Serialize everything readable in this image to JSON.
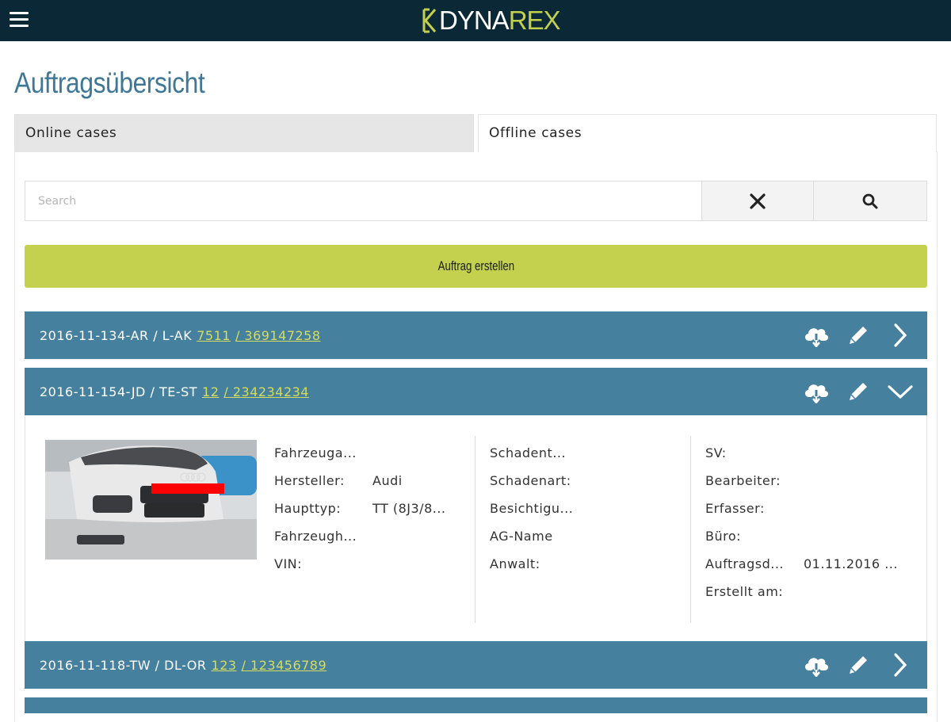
{
  "header": {
    "logo_part1": "DYNA",
    "logo_part2": "REX"
  },
  "page": {
    "title": "Auftragsübersicht"
  },
  "tabs": [
    {
      "label": "Online cases",
      "active": true
    },
    {
      "label": "Offline cases",
      "active": false
    }
  ],
  "search": {
    "placeholder": "Search",
    "value": ""
  },
  "create_button": {
    "label": "Auftrag erstellen"
  },
  "cases": [
    {
      "id": "2016-11-134-AR",
      "plate_prefix": "/ L-AK",
      "plate_number": "7511",
      "claim_number": "/ 369147258",
      "expanded": false
    },
    {
      "id": "2016-11-154-JD",
      "plate_prefix": "/ TE-ST",
      "plate_number": "12",
      "claim_number": "/ 234234234",
      "expanded": true
    },
    {
      "id": "2016-11-118-TW",
      "plate_prefix": "/ DL-OR",
      "plate_number": "123",
      "claim_number": "/ 123456789",
      "expanded": false
    }
  ],
  "case_detail": {
    "col1": [
      {
        "label": "Fahrzeuga...",
        "value": ""
      },
      {
        "label": "Hersteller:",
        "value": "Audi"
      },
      {
        "label": "Haupttyp:",
        "value": "TT (8J3/8..."
      },
      {
        "label": "Fahrzeugh...",
        "value": ""
      },
      {
        "label": "VIN:",
        "value": ""
      }
    ],
    "col2": [
      {
        "label": "Schadent...",
        "value": ""
      },
      {
        "label": "Schadenart:",
        "value": ""
      },
      {
        "label": "Besichtigu...",
        "value": ""
      },
      {
        "label": "AG-Name",
        "value": ""
      },
      {
        "label": "Anwalt:",
        "value": ""
      }
    ],
    "col3": [
      {
        "label": "SV:",
        "value": ""
      },
      {
        "label": "Bearbeiter:",
        "value": ""
      },
      {
        "label": "Erfasser:",
        "value": ""
      },
      {
        "label": "Büro:",
        "value": ""
      },
      {
        "label": "Auftragsd...",
        "value": "01.11.2016 ..."
      },
      {
        "label": "Erstellt am:",
        "value": ""
      }
    ]
  },
  "icons": {
    "menu": "hamburger-icon",
    "clear": "close-icon",
    "search": "search-icon",
    "download": "cloud-download-icon",
    "edit": "pencil-icon",
    "open": "chevron-right-icon",
    "collapse": "chevron-down-icon"
  },
  "colors": {
    "topbar": "#0b2836",
    "accent": "#c3d14f",
    "case_header": "#45809f",
    "title": "#3e7896",
    "link": "#d6dc5b"
  }
}
